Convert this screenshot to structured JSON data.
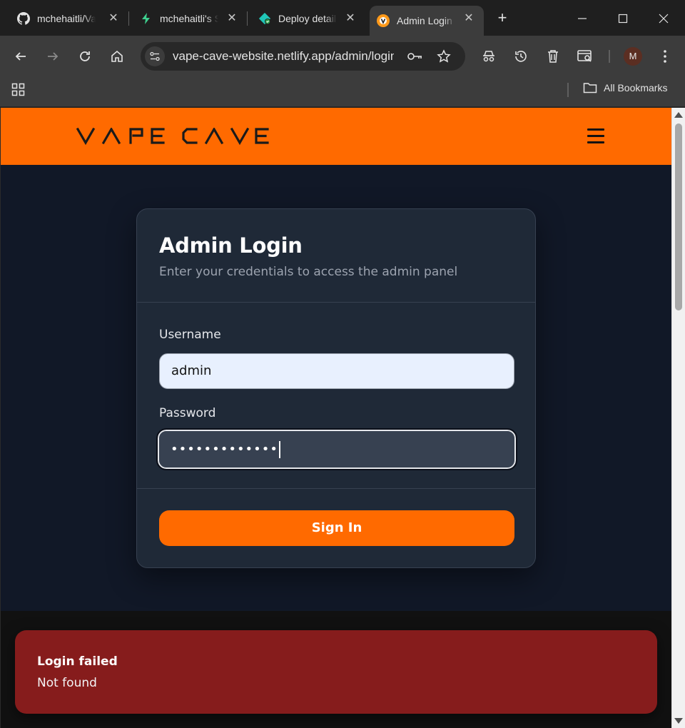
{
  "browser": {
    "tabs": [
      {
        "title": "mchehaitli/Vape-Cave",
        "icon": "github-icon",
        "active": false
      },
      {
        "title": "mchehaitli's Supabase",
        "icon": "supabase-icon",
        "active": false
      },
      {
        "title": "Deploy details",
        "icon": "netlify-icon",
        "active": false
      },
      {
        "title": "Admin Login",
        "icon": "vape-cave-favicon",
        "active": true
      }
    ],
    "new_tab_label": "+",
    "url": "vape-cave-website.netlify.app/admin/login",
    "profile_initial": "M",
    "bookmarks": {
      "all_label": "All Bookmarks"
    }
  },
  "site": {
    "logo_text": "VAPE CAVE",
    "brand_color": "#ff6a00"
  },
  "login": {
    "title": "Admin Login",
    "subtitle": "Enter your credentials to access the admin panel",
    "username_label": "Username",
    "username_value": "admin",
    "password_label": "Password",
    "password_value": "•••••••••••••",
    "submit_label": "Sign In"
  },
  "toast": {
    "title": "Login failed",
    "message": "Not found",
    "color": "#861c1c"
  }
}
